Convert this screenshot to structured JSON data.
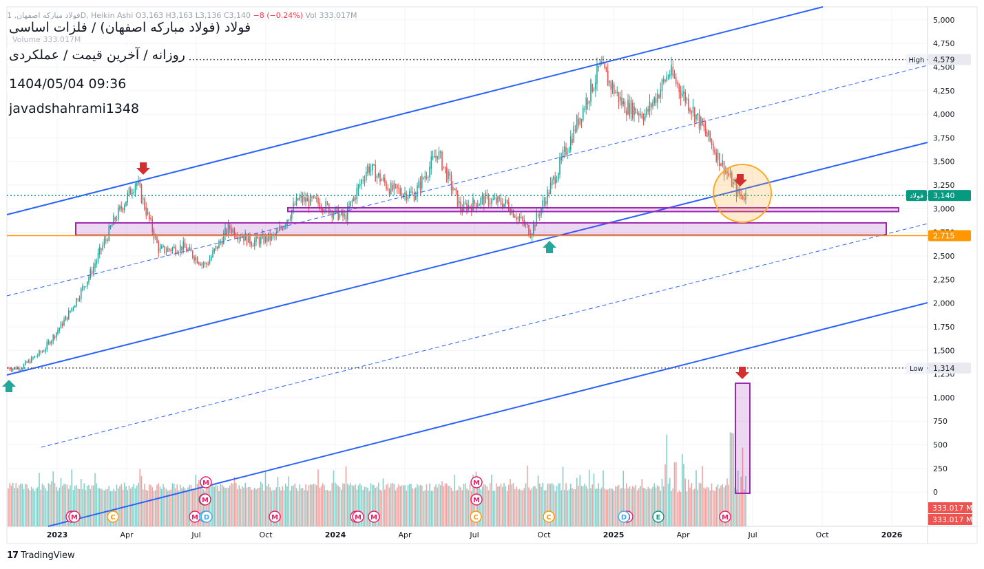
{
  "header": {
    "symbol_interval": "فولاد مبارکه اصفهان, 1D, Heikin Ashi",
    "ohlc": "O3,163 H3,163 L3,136 C3,140",
    "change": "−8 (−0.24%)",
    "volume_label": "Vol 333.017M",
    "volume_pane_label": "Volume 333.017M"
  },
  "overlay_text": {
    "line1": "فولاد (فولاد مبارکه اصفهان) / فلزات اساسی",
    "line2": "روزانه / آخرین قیمت / عملکردی",
    "line3": "1404/05/04 09:36",
    "line4": "javadshahrami1348"
  },
  "branding": {
    "logo": "17",
    "name": "TradingView"
  },
  "colors": {
    "up": "#26a69a",
    "down": "#ef5350",
    "channel": "#2962ff",
    "support": "#ff9800",
    "zone": "#9c27b0",
    "dotted": "#089981",
    "circle": "#ffa726"
  },
  "chart_data": {
    "type": "candlestick",
    "chart_style": "Heikin Ashi",
    "interval": "1D",
    "y_axis": {
      "scale": "linear",
      "ticks": [
        "5,000",
        "4,750",
        "4,500",
        "4,250",
        "4,000",
        "3,750",
        "3,500",
        "3,250",
        "3,000",
        "2,750",
        "2,500",
        "2,250",
        "2,000",
        "1,750",
        "1,500",
        "1,250",
        "1,000",
        "750",
        "500",
        "250",
        "0"
      ]
    },
    "x_axis": {
      "ticks": [
        "2023",
        "Apr",
        "Jul",
        "Oct",
        "2024",
        "Apr",
        "Jul",
        "Oct",
        "2025",
        "Apr",
        "Jul",
        "Oct",
        "2026"
      ]
    },
    "price_anchors": [
      {
        "date": "2022-12",
        "close": 1314
      },
      {
        "date": "2023-01",
        "close": 1500
      },
      {
        "date": "2023-02",
        "close": 1850
      },
      {
        "date": "2023-03",
        "close": 2300
      },
      {
        "date": "2023-04",
        "close": 2850
      },
      {
        "date": "2023-05",
        "close": 3300
      },
      {
        "date": "2023-06",
        "close": 2550
      },
      {
        "date": "2023-07",
        "close": 2600
      },
      {
        "date": "2023-08",
        "close": 2400
      },
      {
        "date": "2023-09",
        "close": 2800
      },
      {
        "date": "2023-10",
        "close": 2650
      },
      {
        "date": "2023-11",
        "close": 2700
      },
      {
        "date": "2023-12",
        "close": 3100
      },
      {
        "date": "2024-01",
        "close": 3050
      },
      {
        "date": "2024-02",
        "close": 2900
      },
      {
        "date": "2024-03",
        "close": 3450
      },
      {
        "date": "2024-04",
        "close": 3200
      },
      {
        "date": "2024-05",
        "close": 3150
      },
      {
        "date": "2024-06",
        "close": 3600
      },
      {
        "date": "2024-07",
        "close": 3000
      },
      {
        "date": "2024-08",
        "close": 3100
      },
      {
        "date": "2024-09",
        "close": 3050
      },
      {
        "date": "2024-10",
        "close": 2750
      },
      {
        "date": "2024-11",
        "close": 3300
      },
      {
        "date": "2024-12",
        "close": 3900
      },
      {
        "date": "2025-01",
        "close": 4500
      },
      {
        "date": "2025-02",
        "close": 4100
      },
      {
        "date": "2025-03",
        "close": 4000
      },
      {
        "date": "2025-04",
        "close": 4450
      },
      {
        "date": "2025-05",
        "close": 4050
      },
      {
        "date": "2025-06",
        "close": 3600
      },
      {
        "date": "2025-07",
        "close": 3140
      }
    ],
    "levels": [
      {
        "label": "High",
        "value": 4579,
        "display": "4,579"
      },
      {
        "label": "Low",
        "value": 1314,
        "display": "1,314"
      },
      {
        "label": "فولاد",
        "value": 3140,
        "display": "3,140"
      },
      {
        "label": "",
        "value": 2715,
        "display": "2,715"
      }
    ],
    "support_zones": [
      {
        "from": 2720,
        "to": 2850
      },
      {
        "from": 2970,
        "to": 3010
      }
    ],
    "volume": {
      "last_value": "333.017 M",
      "last_value_2": "333.017 M"
    },
    "event_markers": [
      "M",
      "M",
      "C",
      "M",
      "D",
      "M",
      "E",
      "M",
      "M",
      "M",
      "C",
      "M",
      "D",
      "E",
      "M",
      "M",
      "M",
      "C",
      "M",
      "M",
      "D"
    ]
  }
}
